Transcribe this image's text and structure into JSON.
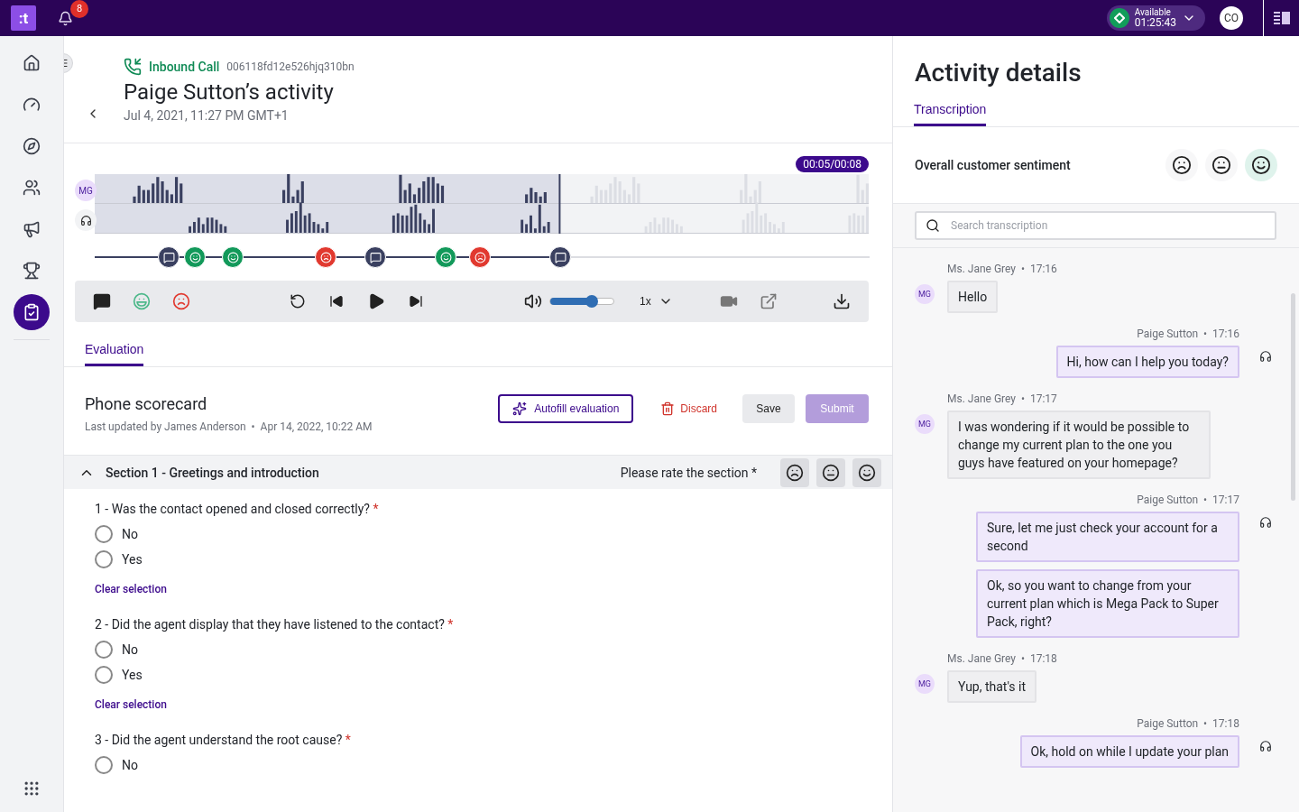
{
  "topbar": {
    "logo": ":t",
    "notifications": "8",
    "status": {
      "label": "Available",
      "time": "01:25:43"
    },
    "avatar": "CO"
  },
  "nav": [
    {
      "selected": false
    },
    {
      "selected": false
    },
    {
      "selected": false
    },
    {
      "selected": false
    },
    {
      "selected": false
    },
    {
      "selected": false
    },
    {
      "selected": true
    }
  ],
  "header": {
    "call_type": "Inbound Call",
    "call_id": "006118fd12e526hjq310bn",
    "title": "Paige Sutton’s activity",
    "date": "Jul 4, 2021, 11:27 PM GMT+1"
  },
  "player": {
    "time": "00:05/00:08",
    "level": 0.6,
    "speaker_badge": "MG",
    "markers": [
      {
        "kind": "comment"
      },
      {
        "kind": "positive"
      },
      {
        "kind": "positive"
      },
      {
        "kind": "negative"
      },
      {
        "kind": "comment"
      },
      {
        "kind": "positive"
      },
      {
        "kind": "negative"
      },
      {
        "kind": "comment"
      }
    ],
    "volume": {
      "level": 0.65
    },
    "speed": "1x"
  },
  "tabs": [
    {
      "label": "Evaluation",
      "selected": true
    }
  ],
  "scorecard": {
    "title": "Phone scorecard",
    "updated": "Last updated by James Anderson  •  Apr 14, 2022, 10:22 AM",
    "buttons": {
      "autofill": "Autofill evaluation",
      "discard": "Discard",
      "save": "Save",
      "submit": "Submit"
    },
    "submit_disabled": true
  },
  "section": {
    "title": "Section 1 - Greetings and introduction",
    "expanded": true,
    "rate_label": "Please rate the section *",
    "ratings": [
      {
        "kind": "negative",
        "selected": false
      },
      {
        "kind": "neutral",
        "selected": false
      },
      {
        "kind": "positive",
        "selected": false
      }
    ]
  },
  "questions": [
    {
      "text": "1 - Was the contact opened and closed correctly?",
      "required": "*",
      "options": [
        {
          "label": "No",
          "selected": false
        },
        {
          "label": "Yes",
          "selected": false
        }
      ],
      "clear": "Clear selection"
    },
    {
      "text": "2 - Did the agent display that they have listened to the contact?",
      "required": "*",
      "options": [
        {
          "label": "No",
          "selected": false
        },
        {
          "label": "Yes",
          "selected": false
        }
      ],
      "clear": "Clear selection"
    },
    {
      "text": "3 - Did the agent understand the root cause?",
      "required": "*",
      "options": [
        {
          "label": "No",
          "selected": false
        }
      ]
    }
  ],
  "activity": {
    "title": "Activity details",
    "tabs": [
      {
        "label": "Transcription",
        "selected": true
      }
    ],
    "sentiment_label": "Overall customer sentiment",
    "sentiments": [
      {
        "kind": "negative",
        "selected": false
      },
      {
        "kind": "neutral",
        "selected": false
      },
      {
        "kind": "positive",
        "selected": true
      }
    ],
    "search": {
      "placeholder": "Search transcription"
    },
    "messages": [
      {
        "kind": "customer",
        "meta": "Ms. Jane Grey  •  17:16",
        "badge": "MG",
        "bubbles": [
          "Hello"
        ]
      },
      {
        "kind": "agent",
        "meta": "Paige Sutton  •  17:16",
        "bubbles": [
          "Hi, how can I help you today?"
        ]
      },
      {
        "kind": "customer",
        "meta": "Ms. Jane Grey  •  17:17",
        "badge": "MG",
        "bubbles": [
          "I was wondering if it would be possible to change my current plan to the one you guys have featured on your homepage?"
        ]
      },
      {
        "kind": "agent",
        "meta": "Paige Sutton  •  17:17",
        "bubbles": [
          "Sure, let me just check your account for a second",
          "Ok, so you want to change from your current plan which is Mega Pack to Super Pack, right?"
        ]
      },
      {
        "kind": "customer",
        "meta": "Ms. Jane Grey  •  17:18",
        "badge": "MG",
        "bubbles": [
          "Yup, that's it"
        ]
      },
      {
        "kind": "agent",
        "meta": "Paige Sutton  •  17:18",
        "bubbles": [
          "Ok, hold on while I update your plan"
        ]
      }
    ]
  }
}
